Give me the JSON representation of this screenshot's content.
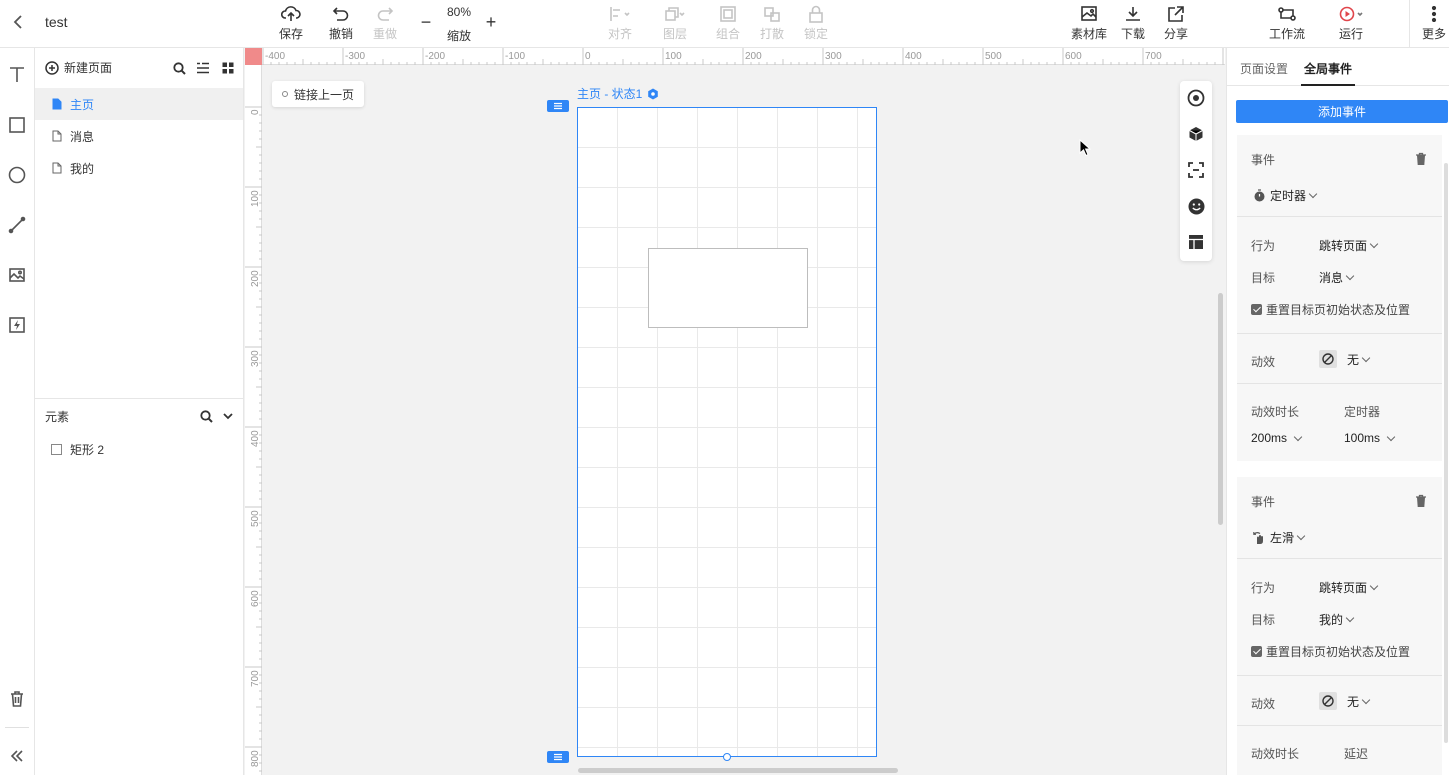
{
  "topbar": {
    "title": "test",
    "save": "保存",
    "undo": "撤销",
    "redo": "重做",
    "zoom_value": "80%",
    "zoom_label": "缩放",
    "zoom_minus": "−",
    "zoom_plus": "+",
    "align": "对齐",
    "layers": "图层",
    "group": "组合",
    "ungroup": "打散",
    "lock": "锁定",
    "assets": "素材库",
    "download": "下载",
    "share": "分享",
    "workflow": "工作流",
    "run": "运行",
    "more": "更多"
  },
  "pages": {
    "new_page": "新建页面",
    "items": [
      {
        "label": "主页",
        "active": true
      },
      {
        "label": "消息",
        "active": false
      },
      {
        "label": "我的",
        "active": false
      }
    ]
  },
  "elements": {
    "title": "元素",
    "items": [
      {
        "label": "矩形 2"
      }
    ]
  },
  "canvas": {
    "link_prev": "链接上一页",
    "artboard_label": "主页 - 状态1",
    "ruler_top": [
      "-400",
      "-300",
      "-200",
      "-100",
      "0",
      "100",
      "200",
      "300",
      "400",
      "500",
      "600",
      "700"
    ],
    "ruler_left": [
      "0",
      "100",
      "200",
      "300",
      "400",
      "500",
      "600",
      "700",
      "800"
    ]
  },
  "right_panel": {
    "tab_page": "页面设置",
    "tab_global": "全局事件",
    "add_event": "添加事件",
    "events": [
      {
        "title": "事件",
        "trigger": "定时器",
        "action_label": "行为",
        "action_value": "跳转页面",
        "target_label": "目标",
        "target_value": "消息",
        "reset_label": "重置目标页初始状态及位置",
        "effect_label": "动效",
        "effect_value": "无",
        "duration_label": "动效时长",
        "duration_value": "200ms",
        "extra_label": "定时器",
        "extra_value": "100ms"
      },
      {
        "title": "事件",
        "trigger": "左滑",
        "action_label": "行为",
        "action_value": "跳转页面",
        "target_label": "目标",
        "target_value": "我的",
        "reset_label": "重置目标页初始状态及位置",
        "effect_label": "动效",
        "effect_value": "无",
        "duration_label": "动效时长",
        "extra_label": "延迟"
      }
    ]
  },
  "colors": {
    "accent": "#2f86f6",
    "ruler_corner": "#f08a8a"
  }
}
